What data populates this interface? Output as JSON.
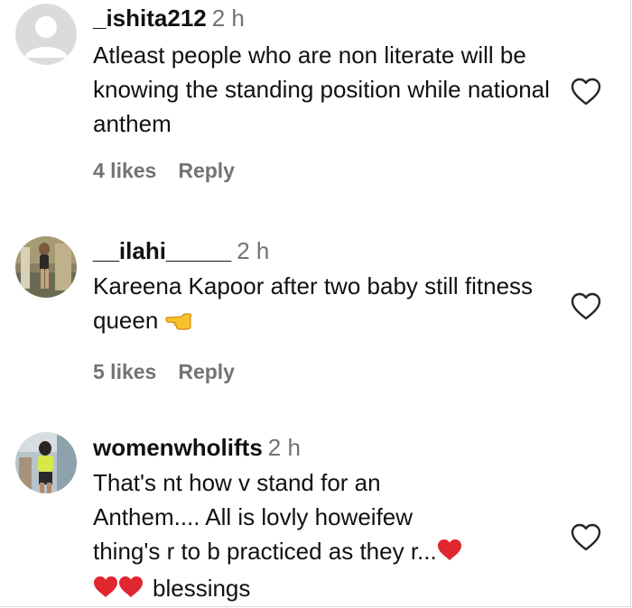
{
  "comments": [
    {
      "username": "_ishita212",
      "time": "2 h",
      "text": "Atleast people who are non literate will be knowing the standing position while national anthem",
      "likes": "4 likes",
      "reply": "Reply",
      "avatar": "default-avatar-icon"
    },
    {
      "username": "__ilahi_____",
      "time": "2 h",
      "text": "Kareena Kapoor after two baby still fitness queen",
      "likes": "5 likes",
      "reply": "Reply",
      "avatar": "profile-photo"
    },
    {
      "username": "womenwholifts",
      "time": "2 h",
      "text_line1": "That's nt how v stand for an",
      "text_line2": "Anthem.... All is lovly howeifew",
      "text_line3": "thing's r to b practiced as they r...",
      "text_line4": "blessings",
      "avatar": "profile-photo"
    }
  ],
  "icons": {
    "like": "heart-outline-icon",
    "pointing": "backhand-index-pointing-left-emoji",
    "red_heart": "red-heart-emoji"
  },
  "colors": {
    "text": "#111111",
    "secondary": "#737373",
    "heart_emoji": "#e0262e"
  }
}
